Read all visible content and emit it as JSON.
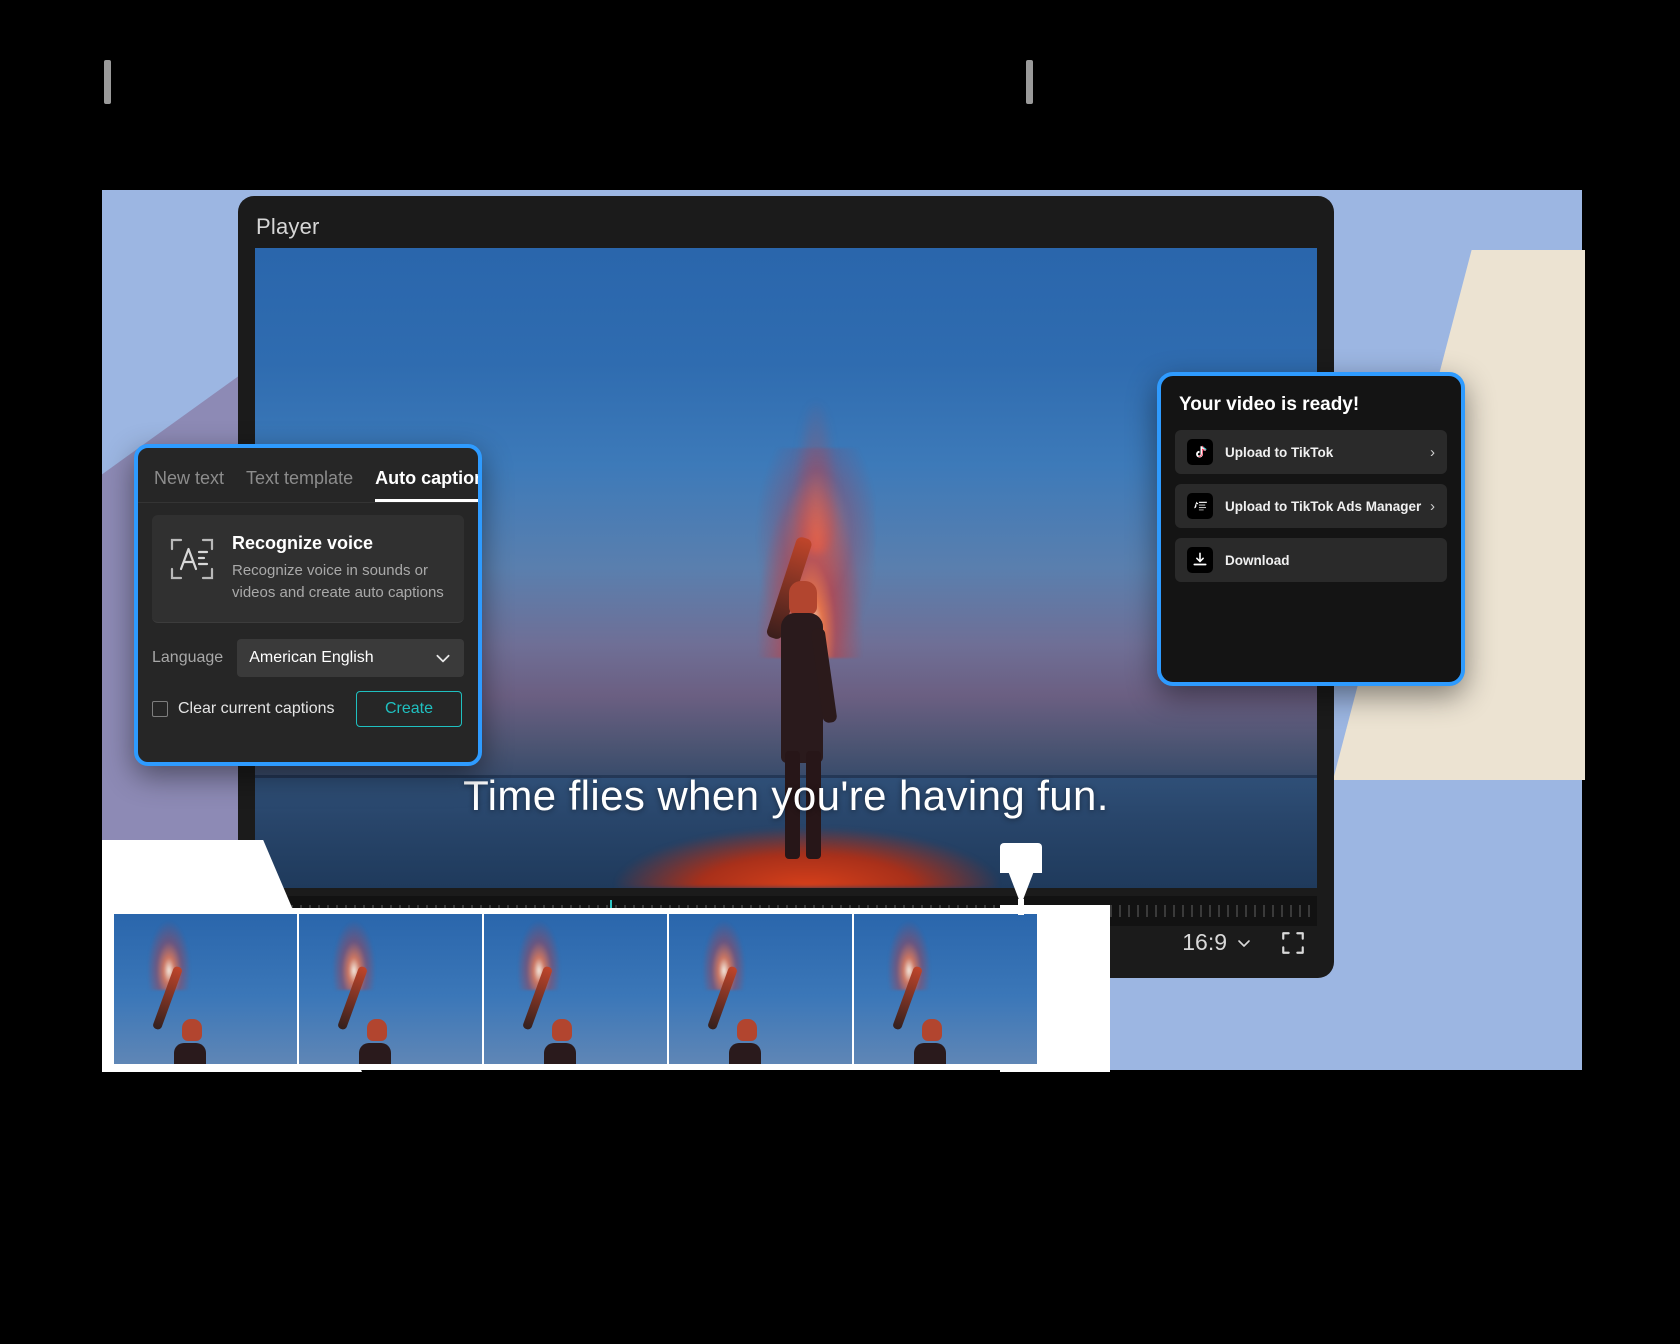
{
  "colors": {
    "accent_blue": "#2e9bff",
    "bg_blue": "#9cb6e2",
    "bg_cream": "#ece3d2",
    "bg_purple": "#8d8ab5",
    "teal": "#1fc0c0",
    "panel_dark": "#262626",
    "export_dark": "#141414"
  },
  "editor": {
    "title": "Player",
    "caption_text": "Time flies when you're having fun.",
    "controls": {
      "aspect_ratio": "16:9",
      "aspect_ratio_chevron": "chevron-down-icon",
      "fullscreen": "fullscreen-icon"
    }
  },
  "captions_panel": {
    "tabs": [
      {
        "label": "New text",
        "active": false
      },
      {
        "label": "Text template",
        "active": false
      },
      {
        "label": "Auto captions",
        "active": true
      }
    ],
    "collapse_icon": "«",
    "card": {
      "icon": "recognize-voice-icon",
      "title": "Recognize voice",
      "description": "Recognize voice in sounds or videos and create auto captions"
    },
    "language": {
      "label": "Language",
      "value": "American English",
      "chevron": "chevron-down-icon"
    },
    "clear_captions": {
      "label": "Clear current captions",
      "checked": false
    },
    "create_button": "Create"
  },
  "export_panel": {
    "title": "Your video is ready!",
    "items": [
      {
        "label": "Upload to TikTok",
        "icon": "tiktok-icon",
        "arrow": "›"
      },
      {
        "label": "Upload to TikTok Ads Manager",
        "icon": "tiktok-ads-icon",
        "arrow": "›"
      },
      {
        "label": "Download",
        "icon": "download-icon",
        "arrow": ""
      }
    ]
  },
  "timeline": {
    "frames": [
      "frame-1",
      "frame-2",
      "frame-3",
      "frame-4",
      "frame-5"
    ],
    "playhead": "playhead-marker",
    "trim_handle_left": "trim-handle-left",
    "trim_handle_right": "trim-handle-right"
  }
}
